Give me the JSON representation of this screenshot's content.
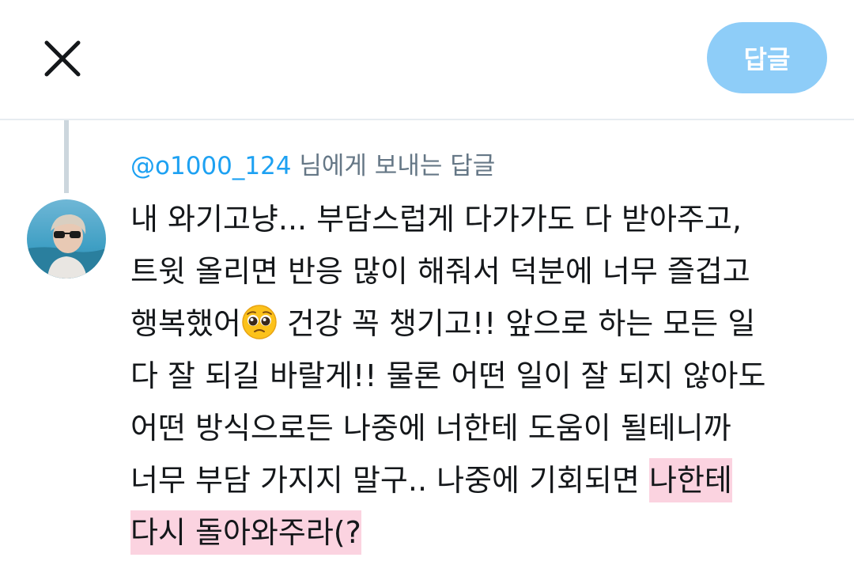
{
  "header": {
    "reply_button_label": "답글"
  },
  "reply_context": {
    "mention": "@o1000_124",
    "suffix": " 님에게 보내는 답글"
  },
  "tweet": {
    "lines": [
      "내 와기고냥... 부담스럽게 다가가도 다 받아주고,",
      "트윗 올리면 반응 많이 해줘서 덕분에 너무 즐겁고",
      "행복했어",
      " 건강 꼭 챙기고!! 앞으로 하는 모든 일",
      "다 잘 되길 바랄게!! 물론 어떤 일이 잘 되지 않아도",
      "어떤 방식으로든 나중에 너한테 도움이 될테니까",
      "너무 부담 가지지 말구.. 나중에 기회되면 ",
      "나한테",
      "다시 돌아와주라(?"
    ],
    "emoji_icon": "pleading-face-emoji"
  },
  "colors": {
    "accent": "#1da1f2",
    "reply_button": "#8ecdf8",
    "highlight": "#fbd3e0",
    "muted_text": "#657786"
  }
}
